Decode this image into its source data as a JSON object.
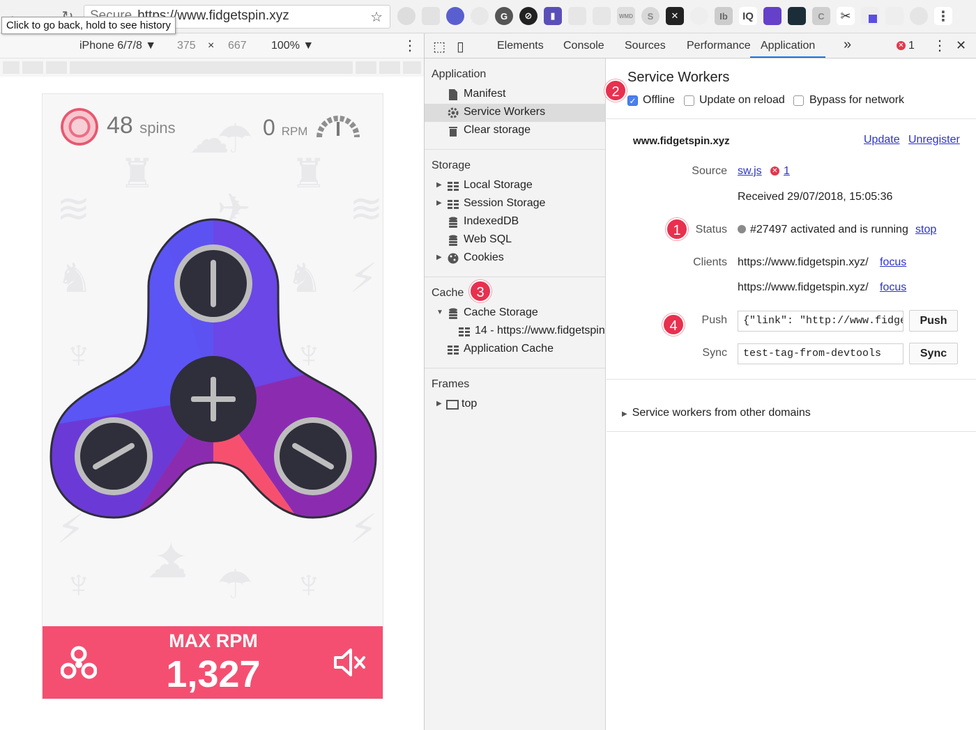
{
  "browser": {
    "url_secure": "Secure",
    "url": "https://www.fidgetspin.xyz",
    "tooltip": "Click to go back, hold to see history"
  },
  "device_bar": {
    "device": "iPhone 6/7/8 ▼",
    "width": "375",
    "times": "×",
    "height": "667",
    "zoom": "100% ▼",
    "more": "⋮"
  },
  "app": {
    "spins_value": "48",
    "spins_unit": "spins",
    "rpm_value": "0",
    "rpm_unit": "RPM",
    "stats_label": "MAX RPM",
    "stats_value": "1,327",
    "colors": {
      "accent": "#f44f71",
      "blue": "#5b55f5",
      "purple": "#8b2cb0",
      "pink": "#f7506f",
      "dark": "#2f2e3b"
    }
  },
  "devtools": {
    "tabs": [
      "Elements",
      "Console",
      "Sources",
      "Performance",
      "Application"
    ],
    "more_tabs": "»",
    "error_count": "1",
    "sidebar": {
      "application_header": "Application",
      "application_items": [
        "Manifest",
        "Service Workers",
        "Clear storage"
      ],
      "storage_header": "Storage",
      "storage_items": [
        "Local Storage",
        "Session Storage",
        "IndexedDB",
        "Web SQL",
        "Cookies"
      ],
      "cache_header": "Cache",
      "cache_items": [
        "Cache Storage",
        "14 - https://www.fidgetspin",
        "Application Cache"
      ],
      "frames_header": "Frames",
      "frames_items": [
        "top"
      ]
    },
    "main": {
      "title": "Service Workers",
      "checkboxes": [
        "Offline",
        "Update on reload",
        "Bypass for network"
      ],
      "origin": "www.fidgetspin.xyz",
      "update_link": "Update",
      "unregister_link": "Unregister",
      "source_label": "Source",
      "source_file": "sw.js",
      "source_errors": "1",
      "received": "Received 29/07/2018, 15:05:36",
      "status_label": "Status",
      "status_text": "#27497 activated and is running",
      "stop_link": "stop",
      "clients_label": "Clients",
      "client_1": "https://www.fidgetspin.xyz/",
      "client_2": "https://www.fidgetspin.xyz/",
      "focus_link": "focus",
      "push_label": "Push",
      "push_value": "{\"link\": \"http://www.fidge",
      "push_button": "Push",
      "sync_label": "Sync",
      "sync_value": "test-tag-from-devtools",
      "sync_button": "Sync",
      "other_domains": "Service workers from other domains"
    },
    "callouts": [
      "1",
      "2",
      "3",
      "4"
    ]
  }
}
